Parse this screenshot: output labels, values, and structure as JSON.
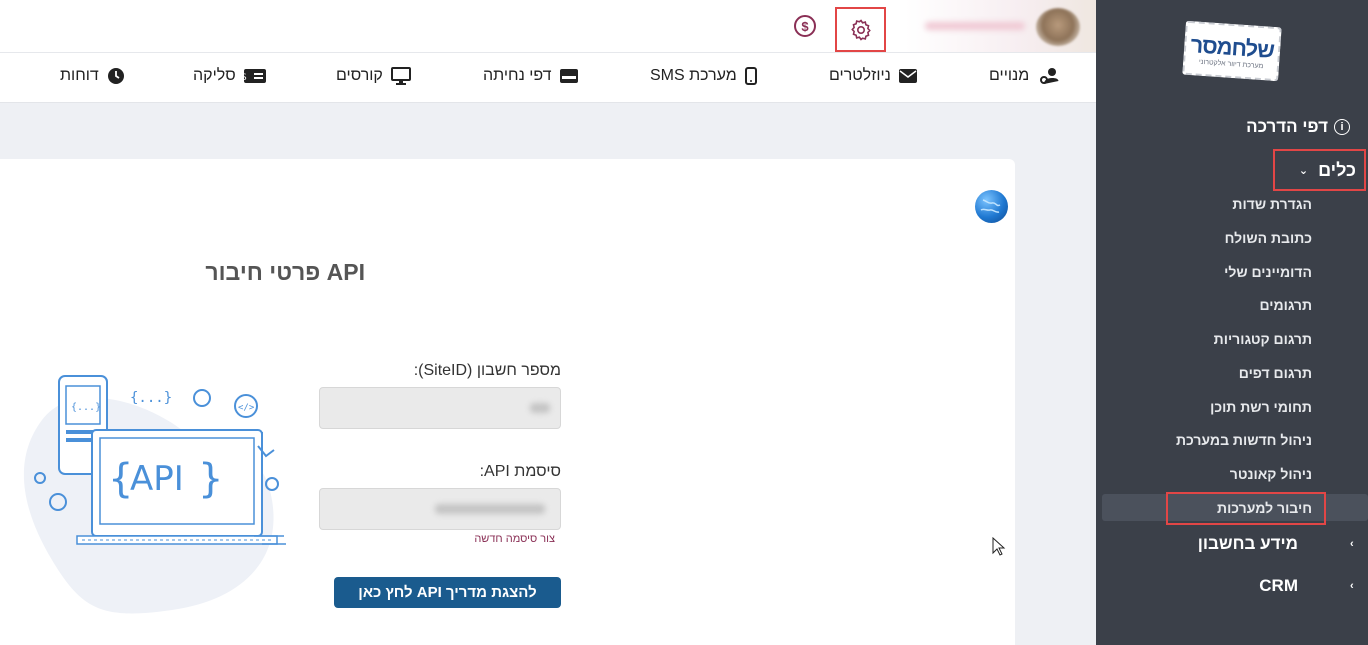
{
  "colors": {
    "sidebar_bg": "#3b4049",
    "highlight": "#e24646",
    "primary_button": "#1a5b8e",
    "link": "#8a2f55"
  },
  "sidebar": {
    "logo": {
      "main": "שלחמסר",
      "sub": "מערכת דיוור אלקטרוני"
    },
    "guide_pages": "דפי הדרכה",
    "tools": "כלים",
    "tools_items": [
      "הגדרת שדות",
      "כתובת השולח",
      "הדומיינים שלי",
      "תרגומים",
      "תרגום קטגוריות",
      "תרגום דפים",
      "תחומי רשת תוכן",
      "ניהול חדשות במערכת",
      "ניהול קאונטר",
      "חיבור למערכות"
    ],
    "account_info": "מידע בחשבון",
    "crm": "CRM"
  },
  "menu": [
    {
      "label": "מנויים",
      "icon": "user-gear-icon"
    },
    {
      "label": "ניוזלטרים",
      "icon": "envelope-icon"
    },
    {
      "label": "מערכת SMS",
      "icon": "mobile-icon"
    },
    {
      "label": "דפי נחיתה",
      "icon": "card-icon"
    },
    {
      "label": "קורסים",
      "icon": "monitor-icon"
    },
    {
      "label": "סליקה",
      "icon": "money-card-icon"
    },
    {
      "label": "דוחות",
      "icon": "clock-icon"
    }
  ],
  "content": {
    "title": "פרטי חיבור API",
    "site_id_label": "מספר חשבון (SiteID):",
    "api_password_label": "סיסמת API:",
    "new_password_link": "צור סיסמה חדשה",
    "guide_button": "להצגת מדריך API לחץ כאן",
    "illustration_text": "API",
    "illustration_braces": "{...}",
    "illustration_code": "</>"
  }
}
